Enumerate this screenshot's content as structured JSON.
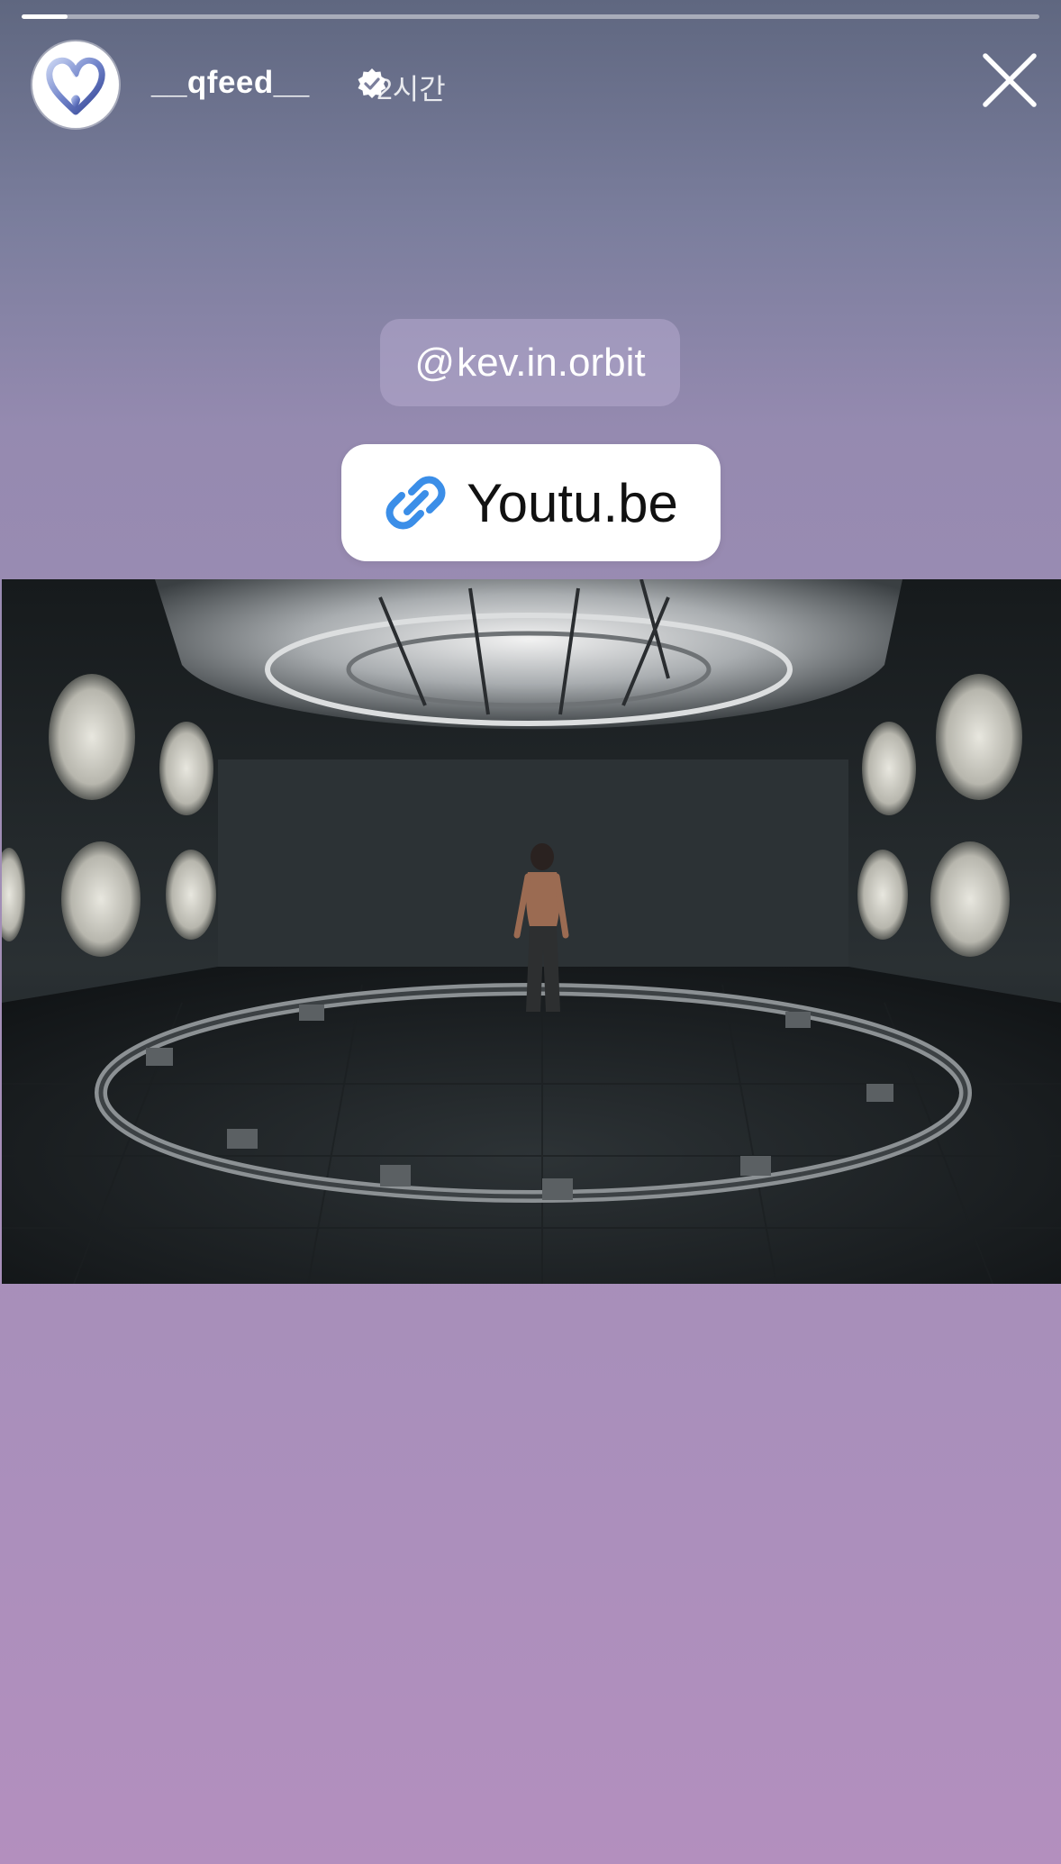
{
  "story": {
    "progress_fraction": 0.045
  },
  "header": {
    "username": "__qfeed__",
    "timestamp": "2시간",
    "avatar_icon": "heart-logo-icon",
    "verified_icon": "verified-badge-icon",
    "close_icon": "close-icon"
  },
  "stickers": {
    "threads_prefix": "@",
    "threads_handle": "kev.in.orbit",
    "link_label": "Youtu.be",
    "link_icon": "link-icon",
    "link_icon_color": "#3b8ee8"
  },
  "colors": {
    "background_top": "#5f6780",
    "background_bottom": "#b38fbe"
  }
}
